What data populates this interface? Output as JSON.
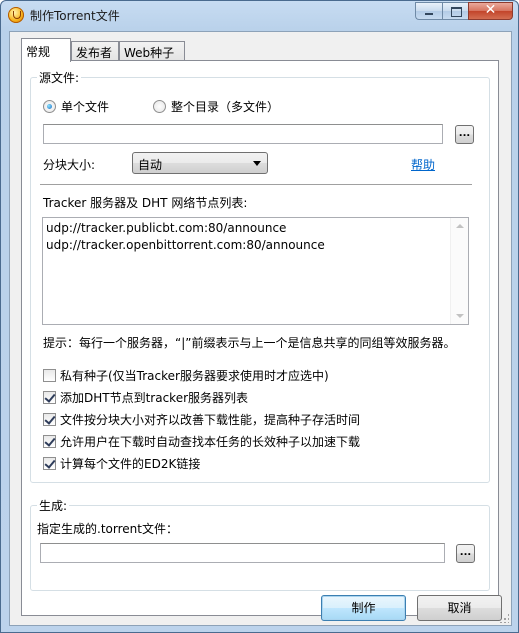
{
  "window": {
    "title": "制作Torrent文件",
    "close_symbol": "✕"
  },
  "tabs": [
    {
      "label": "常规",
      "active": true
    },
    {
      "label": "发布者",
      "active": false
    },
    {
      "label": "Web种子",
      "active": false
    }
  ],
  "source": {
    "legend": "源文件:",
    "radio_single": {
      "label": "单个文件",
      "checked": true
    },
    "radio_dir": {
      "label": "整个目录（多文件）",
      "checked": false
    },
    "path_value": "",
    "browse_label": "..."
  },
  "piece": {
    "label": "分块大小:",
    "selected": "自动",
    "help_link": "帮助"
  },
  "tracker": {
    "label": "Tracker 服务器及 DHT 网络节点列表:",
    "lines": [
      "udp://tracker.publicbt.com:80/announce",
      "udp://tracker.openbittorrent.com:80/announce"
    ],
    "hint": "提示：每行一个服务器，“|”前缀表示与上一个是信息共享的同组等效服务器。"
  },
  "options": [
    {
      "label": "私有种子(仅当Tracker服务器要求使用时才应选中)",
      "checked": false
    },
    {
      "label": "添加DHT节点到tracker服务器列表",
      "checked": true
    },
    {
      "label": "文件按分块大小对齐以改善下载性能，提高种子存活时间",
      "checked": true
    },
    {
      "label": "允许用户在下载时自动查找本任务的长效种子以加速下载",
      "checked": true
    },
    {
      "label": "计算每个文件的ED2K链接",
      "checked": true
    }
  ],
  "output": {
    "legend": "生成:",
    "label": "指定生成的.torrent文件：",
    "path_value": "",
    "browse_label": "..."
  },
  "buttons": {
    "create": "制作",
    "cancel": "取消"
  }
}
